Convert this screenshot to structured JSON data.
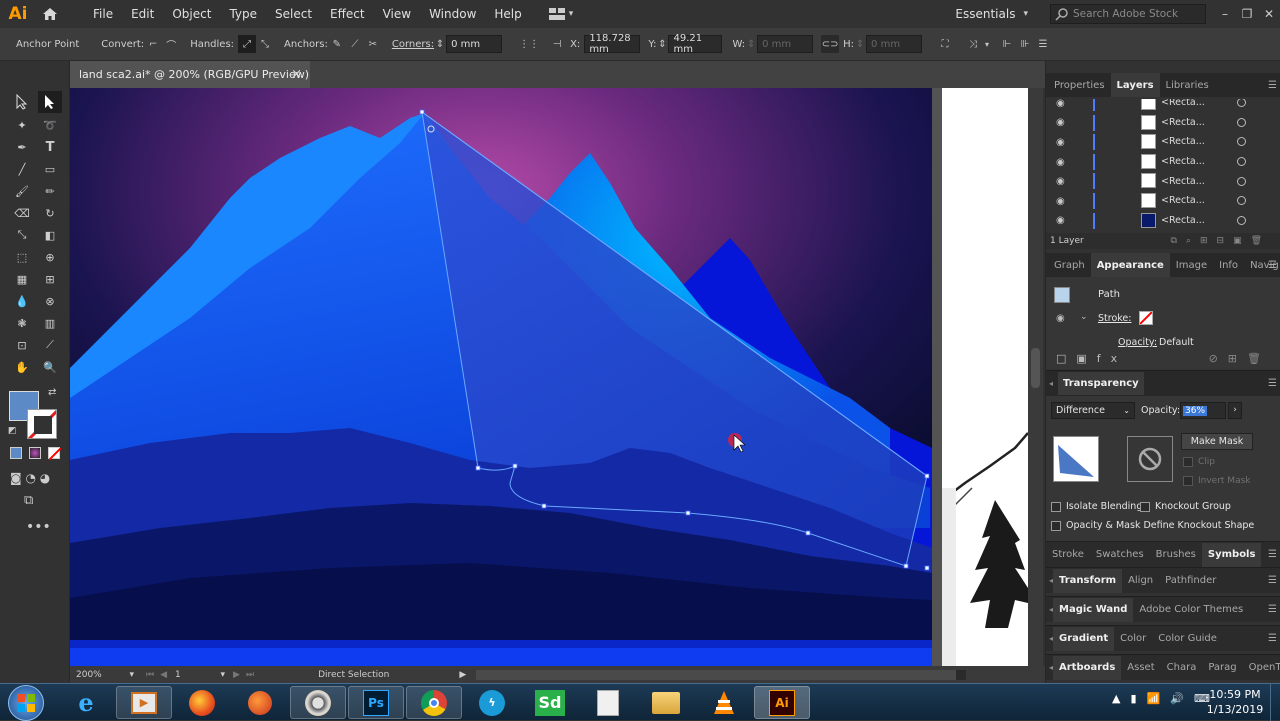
{
  "app": {
    "logo": "Ai"
  },
  "menu": [
    "File",
    "Edit",
    "Object",
    "Type",
    "Select",
    "Effect",
    "View",
    "Window",
    "Help"
  ],
  "workspace": "Essentials",
  "search_placeholder": "Search Adobe Stock",
  "controlbar": {
    "anchor_point": "Anchor Point",
    "convert": "Convert:",
    "handles": "Handles:",
    "anchors": "Anchors:",
    "corners": "Corners:",
    "corners_value": "0 mm",
    "x_label": "X:",
    "x_value": "118.728 mm",
    "y_label": "Y:",
    "y_value": "49.21 mm",
    "w_label": "W:",
    "w_value": "0 mm",
    "h_label": "H:",
    "h_value": "0 mm"
  },
  "document_tab": {
    "title": "land sca2.ai* @ 200% (RGB/GPU Preview)",
    "close": "×"
  },
  "statusbar": {
    "zoom": "200%",
    "artboard": "1",
    "tool": "Direct Selection"
  },
  "panels": {
    "top_tabs": [
      "Properties",
      "Layers",
      "Libraries"
    ],
    "top_active": "Layers",
    "layers": [
      {
        "name": "<Recta..."
      },
      {
        "name": "<Recta..."
      },
      {
        "name": "<Recta..."
      },
      {
        "name": "<Recta..."
      },
      {
        "name": "<Recta..."
      },
      {
        "name": "<Recta..."
      },
      {
        "name": "<Recta..."
      }
    ],
    "layers_count": "1 Layer",
    "mid_tabs": [
      "Graph",
      "Appearance",
      "Image",
      "Info",
      "Navig"
    ],
    "mid_active": "Appearance",
    "appearance": {
      "path": "Path",
      "stroke": "Stroke:",
      "opacity": "Opacity:",
      "opacity_value": "Default"
    },
    "transparency": {
      "title": "Transparency",
      "blend_mode": "Difference",
      "opacity_label": "Opacity:",
      "opacity_value": "36%",
      "make_mask": "Make Mask",
      "clip": "Clip",
      "invert_mask": "Invert Mask",
      "isolate_blending": "Isolate Blending",
      "knockout_group": "Knockout Group",
      "opacity_mask_define": "Opacity & Mask Define Knockout Shape"
    },
    "row_stroke": [
      "Stroke",
      "Swatches",
      "Brushes",
      "Symbols"
    ],
    "row_transform": [
      "Transform",
      "Align",
      "Pathfinder"
    ],
    "row_magic": [
      "Magic Wand",
      "Adobe Color Themes"
    ],
    "row_gradient": [
      "Gradient",
      "Color",
      "Color Guide"
    ],
    "row_artboards": [
      "Artboards",
      "Asset",
      "Chara",
      "Parag",
      "OpenT"
    ]
  },
  "taskbar": {
    "time": "10:59 PM",
    "date": "1/13/2019"
  },
  "colors": {
    "fill": "#5b8ac7",
    "accent": "#ff9a00"
  }
}
